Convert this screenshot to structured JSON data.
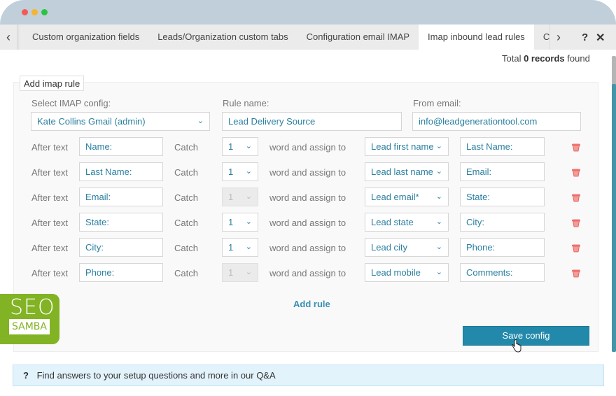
{
  "window": {
    "controls": [
      "close",
      "minimize",
      "maximize"
    ]
  },
  "tabs": {
    "prev_icon": "‹",
    "next_icon": "›",
    "items": [
      {
        "label": "Custom organization fields",
        "active": false
      },
      {
        "label": "Leads/Organization custom tabs",
        "active": false
      },
      {
        "label": "Configuration email IMAP",
        "active": false
      },
      {
        "label": "Imap inbound lead rules",
        "active": true
      },
      {
        "label": "Cre",
        "active": false
      }
    ],
    "help_label": "?",
    "close_label": "✕"
  },
  "records": {
    "prefix": "Total",
    "count": "0 records",
    "suffix": "found"
  },
  "form": {
    "legend": "Add imap rule",
    "imap_config": {
      "label": "Select IMAP config:",
      "value": "Kate Collins Gmail (admin)"
    },
    "rule_name": {
      "label": "Rule name:",
      "value": "Lead Delivery Source"
    },
    "from_email": {
      "label": "From email:",
      "value": "info@leadgenerationtool.com"
    },
    "row_labels": {
      "after_text": "After text",
      "catch": "Catch",
      "assign": "word and assign to"
    },
    "rules": [
      {
        "after_text": "Name:",
        "catch": "1",
        "catch_disabled": false,
        "assign_to": "Lead first name",
        "until_text": "Last Name:"
      },
      {
        "after_text": "Last Name:",
        "catch": "1",
        "catch_disabled": false,
        "assign_to": "Lead last name",
        "until_text": "Email:"
      },
      {
        "after_text": "Email:",
        "catch": "1",
        "catch_disabled": true,
        "assign_to": "Lead email*",
        "until_text": "State:"
      },
      {
        "after_text": "State:",
        "catch": "1",
        "catch_disabled": false,
        "assign_to": "Lead state",
        "until_text": "City:"
      },
      {
        "after_text": "City:",
        "catch": "1",
        "catch_disabled": false,
        "assign_to": "Lead city",
        "until_text": "Phone:"
      },
      {
        "after_text": "Phone:",
        "catch": "1",
        "catch_disabled": true,
        "assign_to": "Lead mobile",
        "until_text": "Comments:"
      }
    ],
    "add_rule_label": "Add rule",
    "save_label": "Save config"
  },
  "logo": {
    "top": "SEO",
    "bottom": "SAMBA"
  },
  "help_bar": {
    "icon": "?",
    "text": "Find answers to your setup questions and more in our Q&A"
  },
  "colors": {
    "accent": "#2389ab",
    "link": "#3a8fb7",
    "delete": "#e8524f",
    "logo_green": "#82b324"
  }
}
